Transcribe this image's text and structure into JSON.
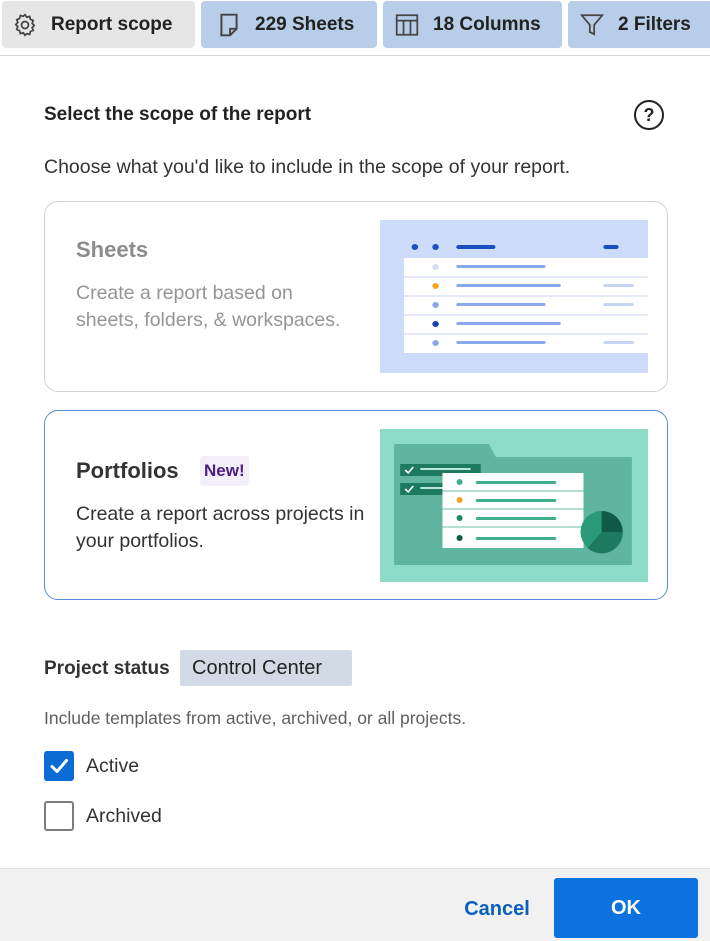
{
  "tabs": [
    {
      "label": "Report scope",
      "icon": "gear-icon"
    },
    {
      "label": "229 Sheets",
      "icon": "sheet-icon"
    },
    {
      "label": "18 Columns",
      "icon": "columns-icon"
    },
    {
      "label": "2 Filters",
      "icon": "filter-icon"
    }
  ],
  "main": {
    "heading": "Select the scope of the report",
    "help_icon_glyph": "?",
    "subtext": "Choose what you'd like to include in the scope of your report."
  },
  "cards": {
    "sheets": {
      "title": "Sheets",
      "description": "Create a report based on sheets, folders, & workspaces."
    },
    "portfolios": {
      "title": "Portfolios",
      "badge": "New!",
      "description": "Create a report across projects in your portfolios."
    }
  },
  "project_status": {
    "label": "Project status",
    "chip": "Control Center",
    "help": "Include templates from active, archived, or all projects.",
    "options": [
      {
        "label": "Active",
        "checked": true
      },
      {
        "label": "Archived",
        "checked": false
      }
    ]
  },
  "footer": {
    "cancel_label": "Cancel",
    "ok_label": "OK"
  },
  "colors": {
    "accent": "#0b72e0",
    "tab_blue": "#b7cde8",
    "sheets_illus_bg": "#cddcfb",
    "portfolio_illus_bg": "#8ddcc8",
    "badge_text": "#4c1d80"
  }
}
